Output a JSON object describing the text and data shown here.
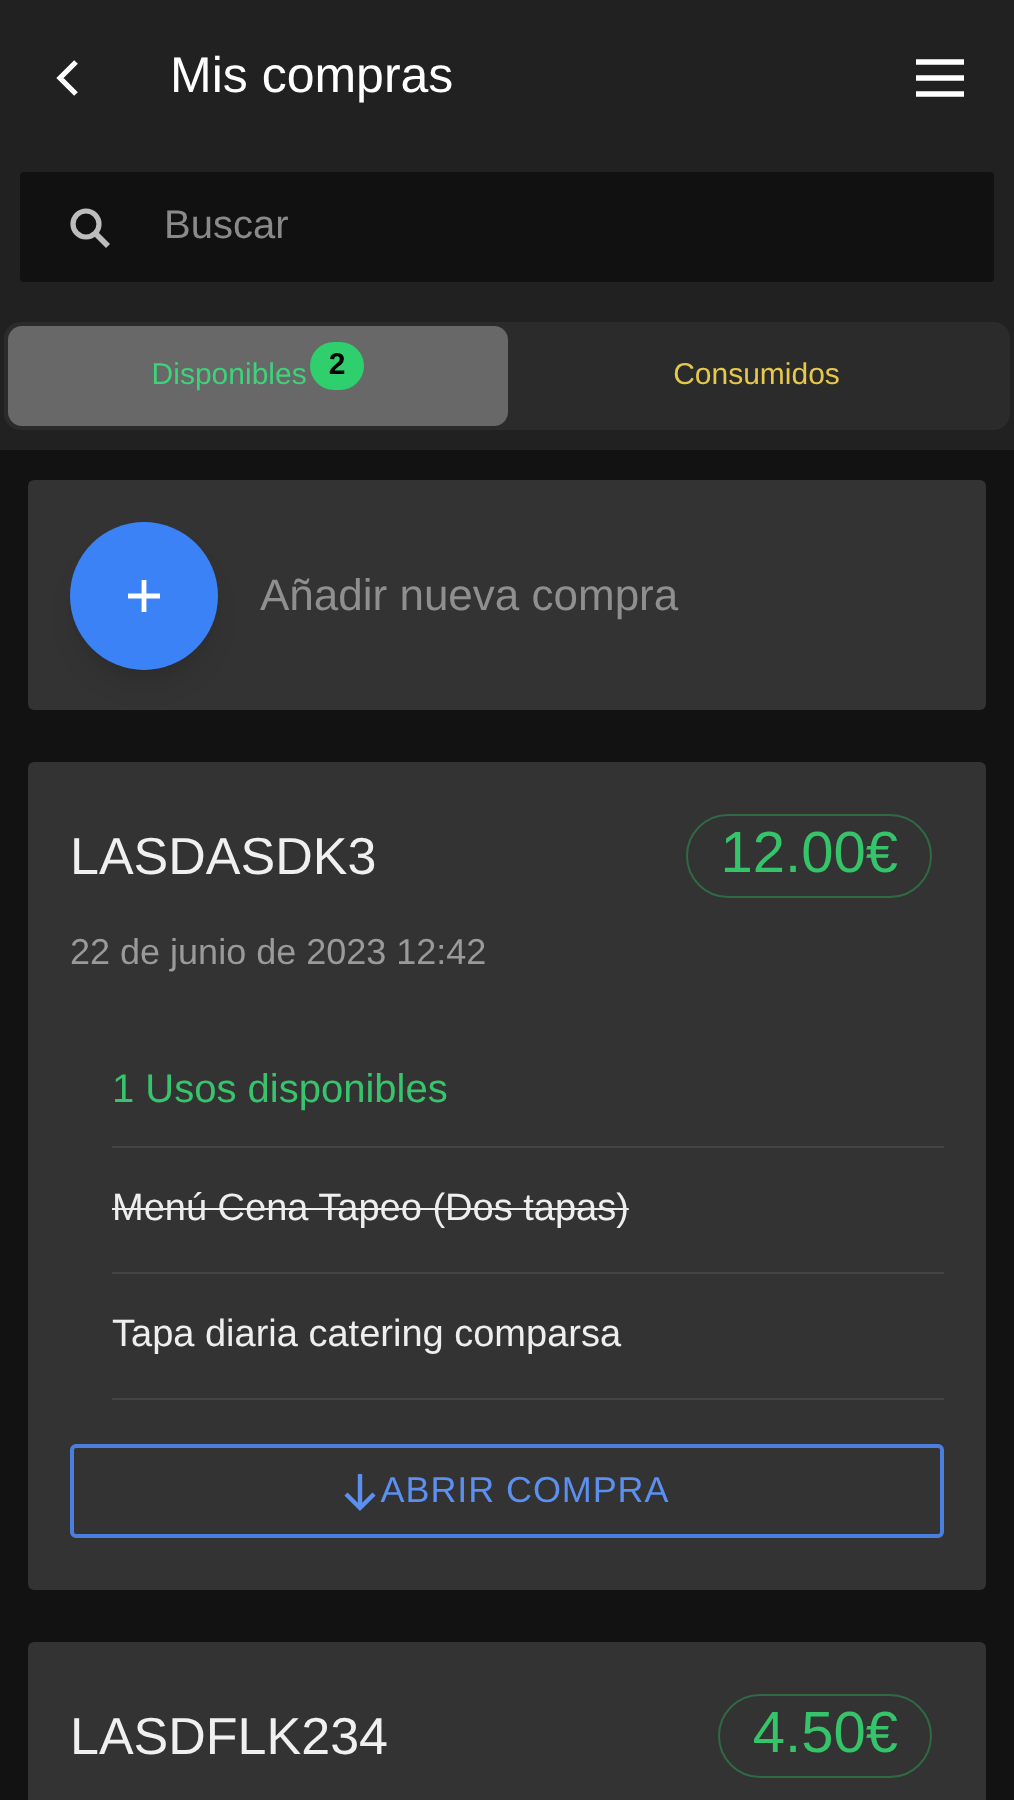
{
  "header": {
    "title": "Mis compras"
  },
  "search": {
    "placeholder": "Buscar"
  },
  "tabs": [
    {
      "label": "Disponibles",
      "badge": "2",
      "selected": true
    },
    {
      "label": "Consumidos",
      "selected": false
    }
  ],
  "add_purchase": {
    "label": "Añadir nueva compra"
  },
  "purchases": [
    {
      "code": "LASDASDK3",
      "price": "12.00€",
      "date": "22 de junio de 2023 12:42",
      "uses": "1 Usos disponibles",
      "items": [
        {
          "label": "Menú Cena Tapeo (Dos tapas)",
          "consumed": true
        },
        {
          "label": "Tapa diaria catering comparsa",
          "consumed": false
        }
      ],
      "button": "ABRIR COMPRA"
    },
    {
      "code": "LASDFLK234",
      "price": "4.50€"
    }
  ]
}
